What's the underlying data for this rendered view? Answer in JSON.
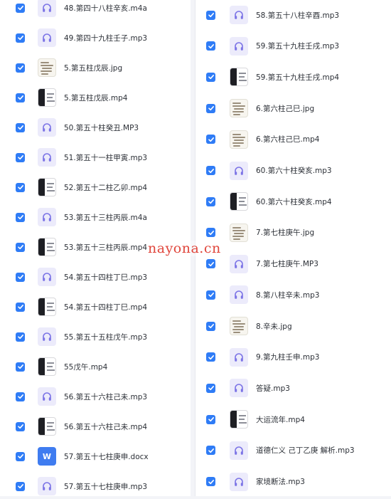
{
  "files_left": [
    {
      "name": "48.第四十八柱辛亥.m4a",
      "type": "audio",
      "checked": true
    },
    {
      "name": "49.第四十九柱壬子.mp3",
      "type": "audio",
      "checked": true
    },
    {
      "name": "5.第五柱戊辰.jpg",
      "type": "image",
      "checked": true
    },
    {
      "name": "5.第五柱戊辰.mp4",
      "type": "video",
      "checked": true
    },
    {
      "name": "50.第五十柱癸丑.MP3",
      "type": "audio",
      "checked": true
    },
    {
      "name": "51.第五十一柱甲寅.mp3",
      "type": "audio",
      "checked": true
    },
    {
      "name": "52.第五十二柱乙卯.mp4",
      "type": "video",
      "checked": true
    },
    {
      "name": "53.第五十三柱丙辰.m4a",
      "type": "audio",
      "checked": true
    },
    {
      "name": "53.第五十三柱丙辰.mp4",
      "type": "video",
      "checked": true
    },
    {
      "name": "54.第五十四柱丁巳.mp3",
      "type": "audio",
      "checked": true
    },
    {
      "name": "54.第五十四柱丁巳.mp4",
      "type": "video",
      "checked": true
    },
    {
      "name": "55.第五十五柱戊午.mp3",
      "type": "audio",
      "checked": true
    },
    {
      "name": "55戊午.mp4",
      "type": "video",
      "checked": true
    },
    {
      "name": "56.第五十六柱己未.mp3",
      "type": "audio",
      "checked": true
    },
    {
      "name": "56.第五十六柱己未.mp4",
      "type": "video",
      "checked": true
    },
    {
      "name": "57.第五十七柱庚申.docx",
      "type": "word",
      "checked": true
    },
    {
      "name": "57.第五十七柱庚申.mp3",
      "type": "audio",
      "checked": true
    }
  ],
  "files_right": [
    {
      "name": "58.第五十八柱辛酉.mp3",
      "type": "audio",
      "checked": true
    },
    {
      "name": "59.第五十九柱壬戌.mp3",
      "type": "audio",
      "checked": true
    },
    {
      "name": "59.第五十九柱壬戌.mp4",
      "type": "video",
      "checked": true
    },
    {
      "name": "6.第六柱己巳.jpg",
      "type": "image",
      "checked": true
    },
    {
      "name": "6.第六柱己巳.mp4",
      "type": "image",
      "checked": true
    },
    {
      "name": "60.第六十柱癸亥.mp3",
      "type": "audio",
      "checked": true
    },
    {
      "name": "60.第六十柱癸亥.mp4",
      "type": "video",
      "checked": true
    },
    {
      "name": "7.第七柱庚午.jpg",
      "type": "image",
      "checked": true
    },
    {
      "name": "7.第七柱庚午.MP3",
      "type": "audio",
      "checked": true
    },
    {
      "name": "8.第八柱辛未.mp3",
      "type": "audio",
      "checked": true
    },
    {
      "name": "8.辛未.jpg",
      "type": "image",
      "checked": true
    },
    {
      "name": "9.第九柱壬申.mp3",
      "type": "audio",
      "checked": true
    },
    {
      "name": "答疑.mp3",
      "type": "audio",
      "checked": true
    },
    {
      "name": "大运流年.mp4",
      "type": "video",
      "checked": true
    },
    {
      "name": "道德仁义 己丁乙庚 解析.mp3",
      "type": "audio",
      "checked": true
    },
    {
      "name": "家境断法.mp3",
      "type": "audio",
      "checked": true
    }
  ],
  "watermark": "nayona.cn",
  "colors": {
    "checkbox": "#2f7cf6",
    "audio_icon": "#7b73e6",
    "audio_icon_bg": "#ecebfb",
    "word_icon": "#3f7cf0",
    "watermark": "#e0463c"
  },
  "icons": {
    "audio": "headphones-icon",
    "word": "word-doc-icon",
    "image": "image-thumbnail",
    "video": "video-thumbnail",
    "check": "checkmark-icon"
  }
}
